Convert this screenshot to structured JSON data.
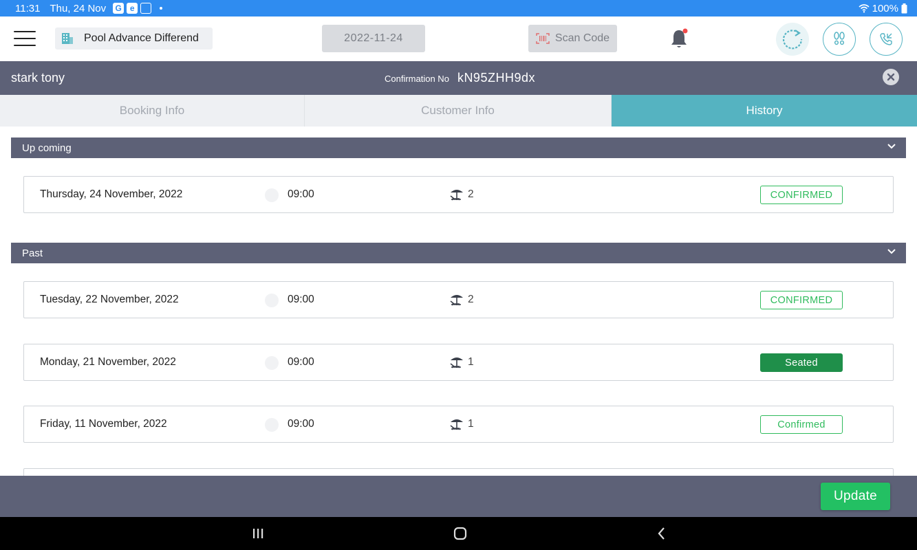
{
  "status_bar": {
    "time": "11:31",
    "date": "Thu, 24 Nov",
    "battery": "100%"
  },
  "header": {
    "venue": "Pool Advance Differend",
    "date": "2022-11-24",
    "scan_label": "Scan Code"
  },
  "customer": {
    "name": "stark tony",
    "confirmation_label": "Confirmation No",
    "confirmation_no": "kN95ZHH9dx"
  },
  "tabs": [
    {
      "label": "Booking Info"
    },
    {
      "label": "Customer Info"
    },
    {
      "label": "History"
    }
  ],
  "active_tab": "History",
  "sections": {
    "upcoming": {
      "title": "Up coming",
      "rows": [
        {
          "date": "Thursday, 24 November, 2022",
          "time": "09:00",
          "count": "2",
          "status": "CONFIRMED"
        }
      ]
    },
    "past": {
      "title": "Past",
      "rows": [
        {
          "date": "Tuesday, 22 November, 2022",
          "time": "09:00",
          "count": "2",
          "status": "CONFIRMED"
        },
        {
          "date": "Monday, 21 November, 2022",
          "time": "09:00",
          "count": "1",
          "status": "Seated"
        },
        {
          "date": "Friday, 11 November, 2022",
          "time": "09:00",
          "count": "1",
          "status": "Confirmed"
        }
      ]
    }
  },
  "footer": {
    "update_label": "Update"
  },
  "colors": {
    "status_bar": "#2f8cf0",
    "dark_bar": "#5d6177",
    "tab_active": "#55b3c1",
    "confirmed_green": "#2fbb5c",
    "seated_green": "#1f8f4a",
    "update_green": "#23c063"
  },
  "icons": [
    "menu-icon",
    "building-icon",
    "barcode-icon",
    "bell-icon",
    "refresh-icon",
    "footprints-icon",
    "phone-icon",
    "close-icon",
    "chevron-down-icon",
    "clock-icon",
    "umbrella-chair-icon"
  ]
}
